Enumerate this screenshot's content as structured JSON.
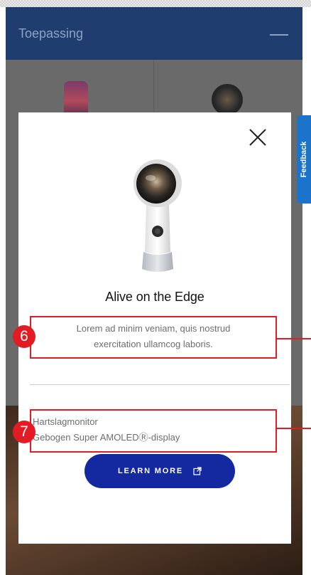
{
  "app": {
    "header_title": "Toepassing"
  },
  "modal": {
    "headline": "Alive on the Edge",
    "description_line1": "Lorem ad minim veniam, quis nostrud",
    "description_line2": "exercitation ullamcog laboris.",
    "features": [
      "Hartslagmonitor",
      "Gebogen Super AMOLEDⓇ-display"
    ],
    "cta_label": "LEARN MORE",
    "close_icon": "close-icon",
    "cta_icon": "external-link-icon"
  },
  "annotations": {
    "marker_6": "6",
    "marker_7": "7"
  },
  "feedback_tab": {
    "label": "Feedback"
  },
  "colors": {
    "header": "#1f3d6e",
    "cta": "#1428a0",
    "annotation": "#e31b23",
    "feedback": "#1b74c9"
  }
}
